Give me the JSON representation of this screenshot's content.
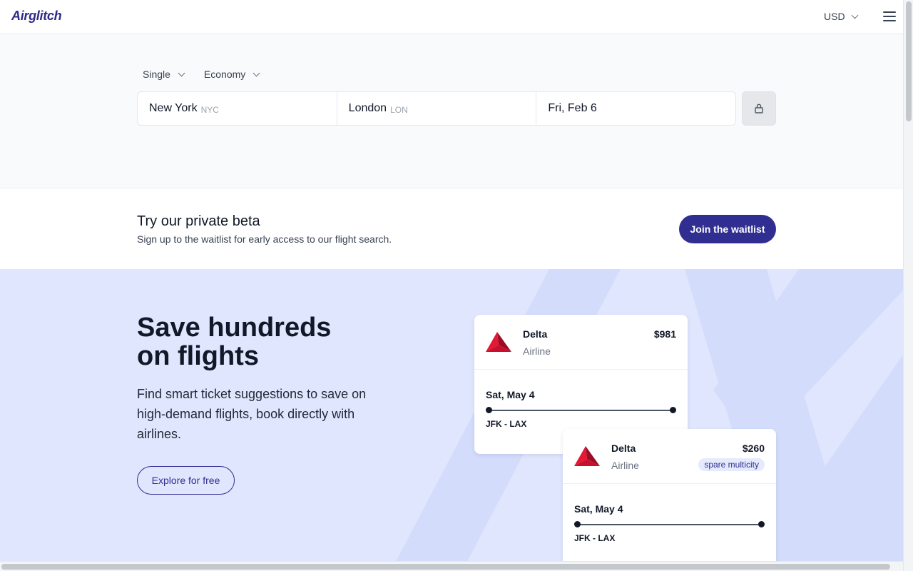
{
  "header": {
    "logo": "Airglitch",
    "currency": "USD"
  },
  "search": {
    "trip_type": "Single",
    "cabin_class": "Economy",
    "origin": {
      "city": "New York",
      "code": "NYC"
    },
    "destination": {
      "city": "London",
      "code": "LON"
    },
    "date": "Fri, Feb 6"
  },
  "beta": {
    "title": "Try our private beta",
    "subtitle": "Sign up to the waitlist for early access to our flight search.",
    "button": "Join the waitlist"
  },
  "hero": {
    "title_line1": "Save hundreds",
    "title_line2": "on flights",
    "description": "Find smart ticket suggestions to save on high-demand flights, book directly with airlines.",
    "button": "Explore for free"
  },
  "cards": [
    {
      "airline": "Delta",
      "type": "Airline",
      "price": "$981",
      "tag": "",
      "date": "Sat, May 4",
      "route": "JFK - LAX"
    },
    {
      "airline": "Delta",
      "type": "Airline",
      "price": "$260",
      "tag": "spare multicity",
      "date": "Sat, May 4",
      "route": "JFK - LAX"
    }
  ],
  "colors": {
    "brand": "#312e91",
    "hero_bg": "#e0e6fd",
    "delta_red": "#c8102e"
  },
  "icons": {
    "currency": "chevron-down-icon",
    "menu": "hamburger-menu-icon",
    "lock": "lock-icon",
    "airline": "delta-logo-icon"
  }
}
